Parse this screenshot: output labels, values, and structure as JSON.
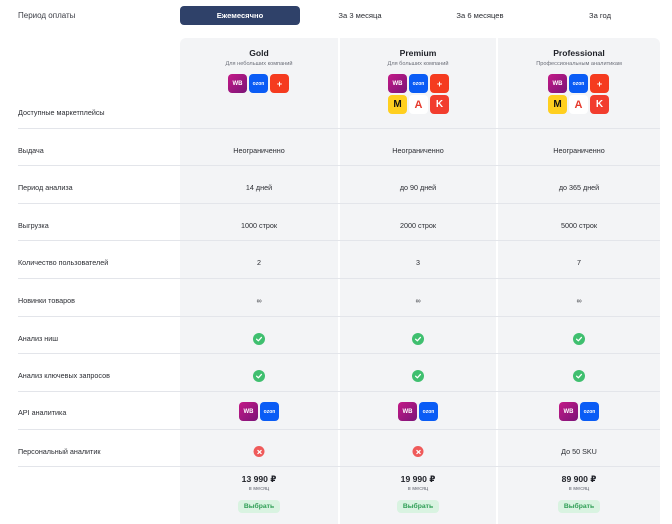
{
  "period": {
    "label": "Период оплаты",
    "options": [
      "Ежемесячно",
      "За 3 месяца",
      "За 6 месяцев",
      "За год"
    ],
    "active": "Ежемесячно"
  },
  "plans": [
    {
      "name": "Gold",
      "subtitle": "Для небольших компаний",
      "price": "13 990 ₽",
      "per": "в месяц",
      "button": "Выбрать",
      "marketplaces": [
        "wb",
        "ozon",
        "megamarket"
      ]
    },
    {
      "name": "Premium",
      "subtitle": "Для больших компаний",
      "price": "19 990 ₽",
      "per": "в месяц",
      "button": "Выбрать",
      "marketplaces": [
        "wb",
        "ozon",
        "megamarket",
        "yandex-market",
        "aliexpress",
        "kazanexpress"
      ]
    },
    {
      "name": "Professional",
      "subtitle": "Профессиональным аналитикам",
      "price": "89 900 ₽",
      "per": "в месяц",
      "button": "Выбрать",
      "marketplaces": [
        "wb",
        "ozon",
        "megamarket",
        "yandex-market",
        "aliexpress",
        "kazanexpress"
      ]
    }
  ],
  "marketplace_labels": {
    "wb": "WB",
    "ozon": "ozon",
    "megamarket": "+",
    "yandex-market": "M",
    "aliexpress": "A",
    "kazanexpress": "K"
  },
  "rows": [
    {
      "label": "Доступные маркетплейсы"
    },
    {
      "label": "Выдача",
      "values": [
        "Неограниченно",
        "Неограниченно",
        "Неограниченно"
      ]
    },
    {
      "label": "Период анализа",
      "values": [
        "14 дней",
        "до 90 дней",
        "до 365 дней"
      ]
    },
    {
      "label": "Выгрузка",
      "values": [
        "1000 строк",
        "2000 строк",
        "5000 строк"
      ]
    },
    {
      "label": "Количество пользователей",
      "values": [
        "2",
        "3",
        "7"
      ]
    },
    {
      "label": "Новинки товаров",
      "values": [
        "∞",
        "∞",
        "∞"
      ]
    },
    {
      "label": "Анализ ниш",
      "values": [
        "yes",
        "yes",
        "yes"
      ]
    },
    {
      "label": "Анализ ключевых запросов",
      "values": [
        "yes",
        "yes",
        "yes"
      ]
    },
    {
      "label": "API аналитика",
      "values": [
        "api",
        "api",
        "api"
      ]
    },
    {
      "label": "Персональный аналитик",
      "values": [
        "no",
        "no",
        "До 50 SKU"
      ]
    }
  ],
  "colors": {
    "active_tab": "#2f4169",
    "check": "#3fbf6f",
    "cross": "#ef5a5a",
    "button_bg": "#d9f3e1",
    "button_text": "#2f9e55"
  }
}
